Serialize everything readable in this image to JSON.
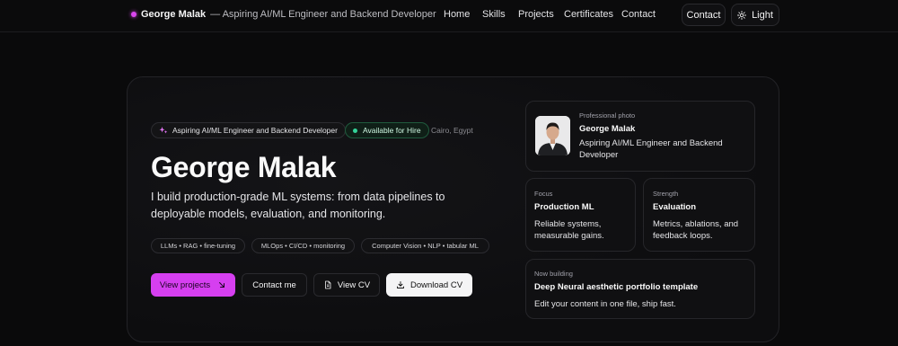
{
  "nav": {
    "brand_name": "George Malak",
    "brand_tagline": "— Aspiring AI/ML Engineer and Backend Developer",
    "links": [
      "Home",
      "Skills",
      "Projects",
      "Certificates",
      "Contact"
    ],
    "contact_button": "Contact",
    "theme_button": "Light"
  },
  "hero": {
    "role_pill": "Aspiring AI/ML Engineer and Backend Developer",
    "hire_pill": "Available for Hire",
    "location": "Cairo, Egypt",
    "title": "George Malak",
    "subtitle": "I build production-grade ML systems: from data pipelines to deployable models, evaluation, and monitoring.",
    "tags": [
      "LLMs • RAG • fine-tuning",
      "MLOps • CI/CD • monitoring",
      "Computer Vision • NLP • tabular ML"
    ],
    "buttons": {
      "view_projects": "View projects",
      "contact_me": "Contact me",
      "view_cv": "View CV",
      "download_cv": "Download CV"
    }
  },
  "profile": {
    "label": "Professional photo",
    "name": "George Malak",
    "role": "Aspiring AI/ML Engineer and Backend Developer"
  },
  "focus": {
    "label": "Focus",
    "title": "Production ML",
    "text": "Reliable systems, measurable gains."
  },
  "strength": {
    "label": "Strength",
    "title": "Evaluation",
    "text": "Metrics, ablations, and feedback loops."
  },
  "building": {
    "label": "Now building",
    "title": "Deep Neural aesthetic portfolio template",
    "text": "Edit your content in one file, ship fast."
  },
  "colors": {
    "accent": "#d63ff0",
    "background": "#0a0a0b",
    "available": "#34d399"
  }
}
